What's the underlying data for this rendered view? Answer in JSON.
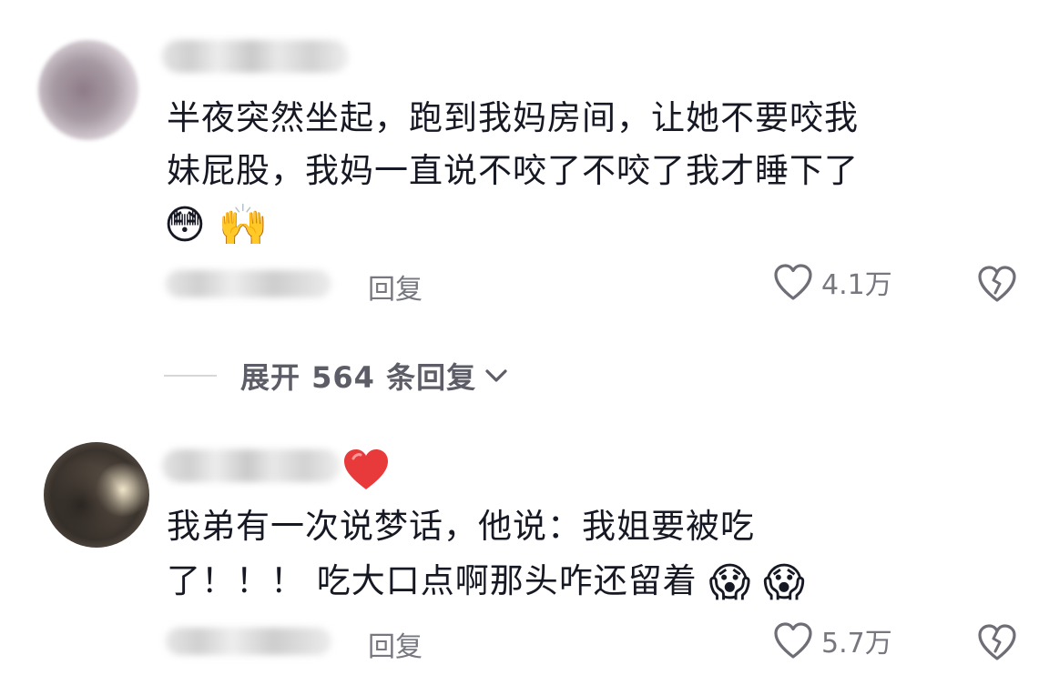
{
  "comments": [
    {
      "lines": [
        "半夜突然坐起，跑到我妈房间，让她不要咬我",
        "妹屁股，我妈一直说不咬了不咬了我才睡下了"
      ],
      "emojis": [
        "😳",
        "🙌"
      ],
      "reply_label": "回复",
      "likes": "4.1万"
    },
    {
      "lines": [
        "我弟有一次说梦话，他说：我姐要被吃",
        "了！！！ 吃大口点啊那头咋还留着"
      ],
      "emojis": [
        "😱",
        "😱"
      ],
      "reply_label": "回复",
      "likes": "5.7万"
    }
  ],
  "expand_replies": "展开 564 条回复",
  "icons": {
    "like": "heart-outline-icon",
    "dislike": "broken-heart-icon",
    "expand": "chevron-down-icon",
    "badge": "red-heart-icon"
  },
  "colors": {
    "text": "#161823",
    "muted": "#76777f",
    "badge": "#e83a3a"
  }
}
